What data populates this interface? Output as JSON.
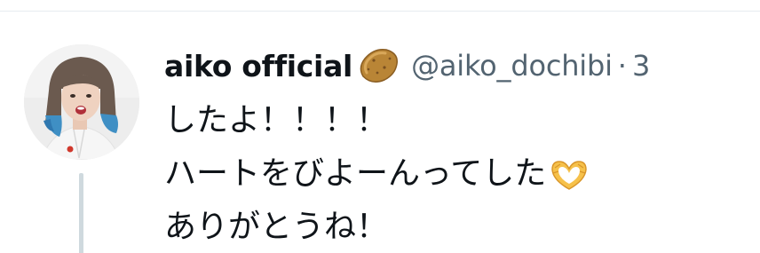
{
  "tweet": {
    "display_name": "aiko official",
    "name_emoji": "potato-icon",
    "handle": "@aiko_dochibi",
    "separator": "·",
    "time": "3",
    "lines": [
      "したよ！！！！",
      "ハートをびよーんってした",
      "ありがとうね！"
    ],
    "line_emoji": "heart-hands-icon"
  },
  "colors": {
    "text": "#0f1419",
    "secondary": "#536471",
    "thread_line": "#cfd9de",
    "divider": "#e6ecf0",
    "hair_blue": "#3f8fc4"
  }
}
